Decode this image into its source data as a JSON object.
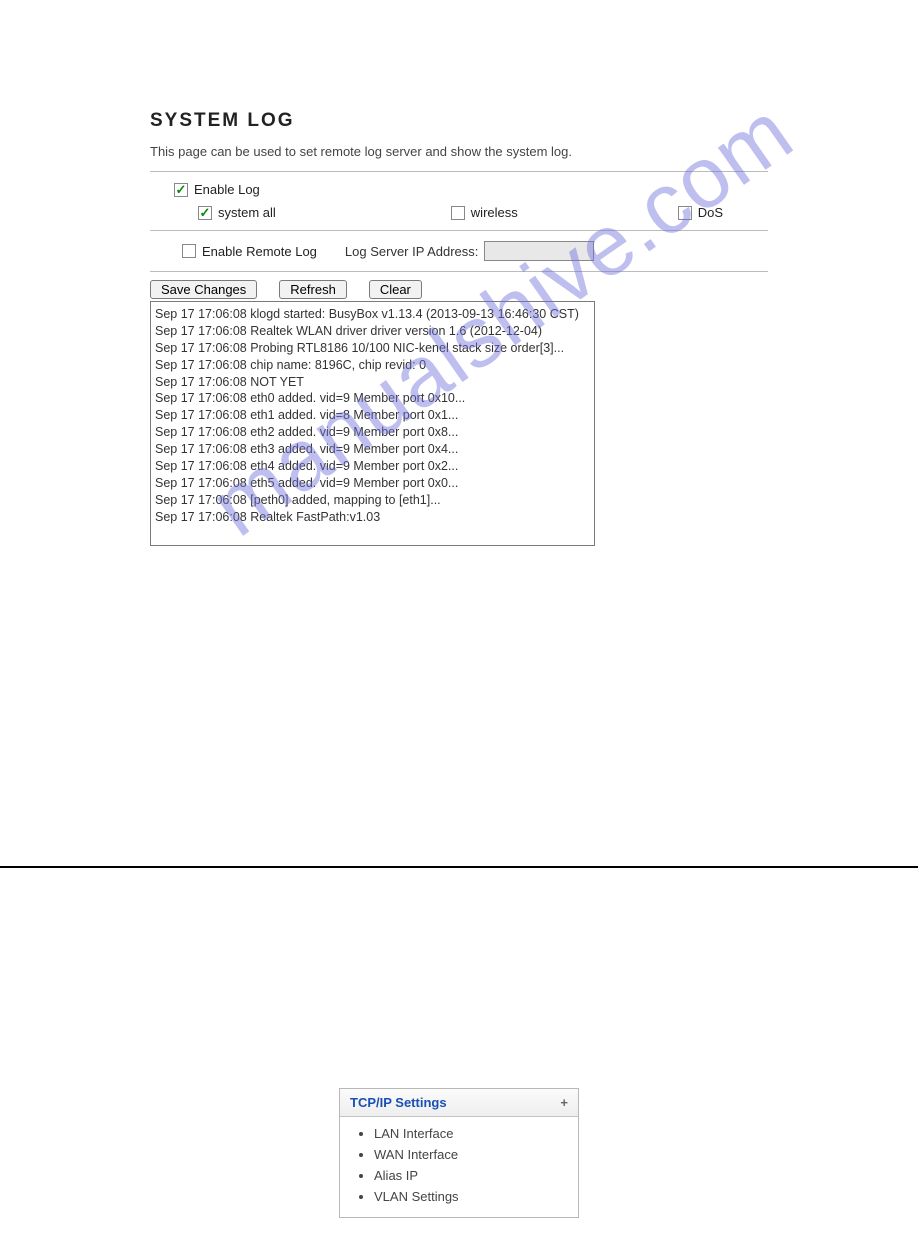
{
  "header": {
    "title": "SYSTEM LOG",
    "description": "This page can be used to set remote log server and show the system log."
  },
  "controls": {
    "enable_log": {
      "label": "Enable Log",
      "checked": true
    },
    "categories": [
      {
        "label": "system all",
        "checked": true
      },
      {
        "label": "wireless",
        "checked": false
      },
      {
        "label": "DoS",
        "checked": false
      }
    ],
    "remote": {
      "enable_label": "Enable Remote Log",
      "enable_checked": false,
      "ip_label": "Log Server IP Address:",
      "ip_value": ""
    },
    "buttons": {
      "save": "Save Changes",
      "refresh": "Refresh",
      "clear": "Clear"
    }
  },
  "log_lines": [
    "Sep 17 17:06:08 klogd started: BusyBox v1.13.4 (2013-09-13 16:46:30 CST)",
    "Sep 17 17:06:08 Realtek WLAN driver driver version 1.6 (2012-12-04)",
    "Sep 17 17:06:08 Probing RTL8186 10/100 NIC-kenel stack size order[3]...",
    "Sep 17 17:06:08 chip name: 8196C, chip revid: 0",
    "Sep 17 17:06:08 NOT YET",
    "Sep 17 17:06:08 eth0 added. vid=9 Member port 0x10...",
    "Sep 17 17:06:08 eth1 added. vid=8 Member port 0x1...",
    "Sep 17 17:06:08 eth2 added. vid=9 Member port 0x8...",
    "Sep 17 17:06:08 eth3 added. vid=9 Member port 0x4...",
    "Sep 17 17:06:08 eth4 added. vid=9 Member port 0x2...",
    "Sep 17 17:06:08 eth5 added. vid=9 Member port 0x0...",
    "Sep 17 17:06:08 [peth0] added, mapping to [eth1]...",
    "Sep 17 17:06:08 Realtek FastPath:v1.03"
  ],
  "watermark": "manualshive.com",
  "panel": {
    "title": "TCP/IP Settings",
    "expand_glyph": "+",
    "items": [
      "LAN Interface",
      "WAN Interface",
      "Alias IP",
      "VLAN Settings"
    ]
  }
}
